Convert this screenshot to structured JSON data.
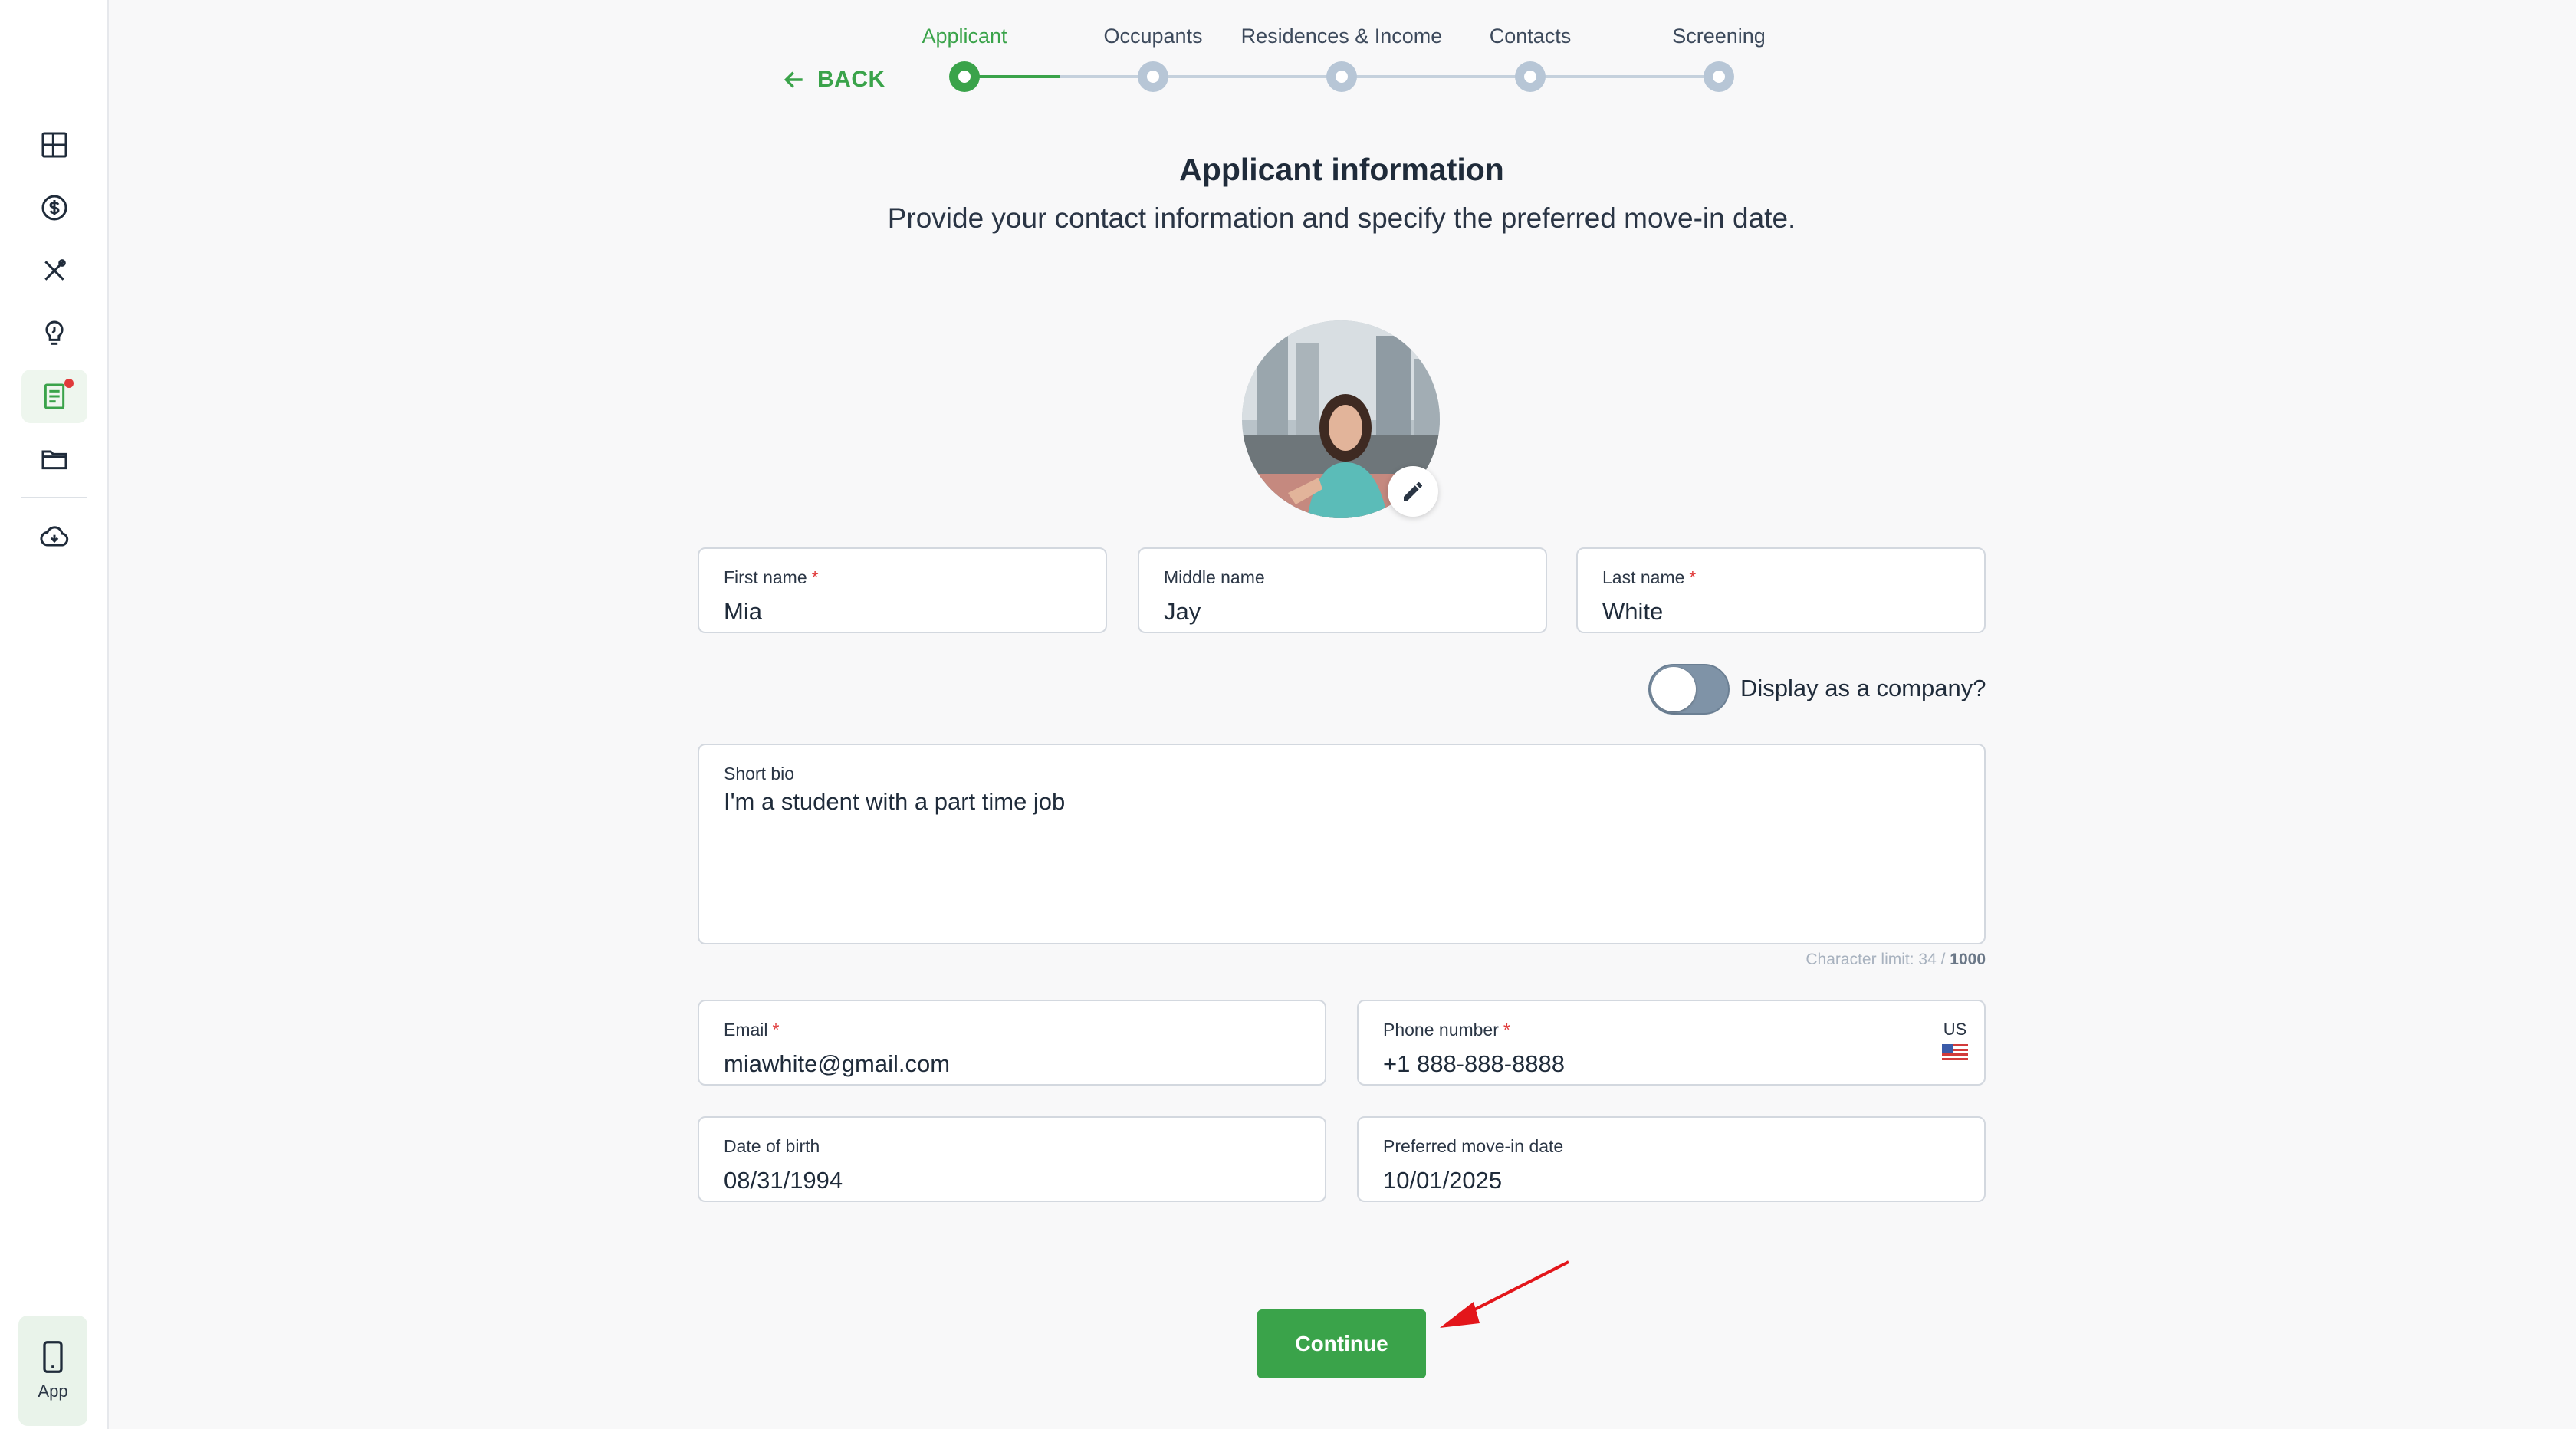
{
  "sidebar": {
    "items": [
      {
        "icon": "dashboard-icon"
      },
      {
        "icon": "dollar-icon"
      },
      {
        "icon": "tools-icon"
      },
      {
        "icon": "lightbulb-icon"
      },
      {
        "icon": "document-icon",
        "active": true,
        "notification": true
      },
      {
        "icon": "folder-icon"
      },
      {
        "icon": "cloud-download-icon"
      }
    ],
    "app_label": "App"
  },
  "nav": {
    "back_label": "BACK"
  },
  "stepper": {
    "steps": [
      "Applicant",
      "Occupants",
      "Residences & Income",
      "Contacts",
      "Screening"
    ],
    "active_index": 0
  },
  "header": {
    "title": "Applicant information",
    "subtitle": "Provide your contact information and specify the preferred move-in date."
  },
  "form": {
    "first_name": {
      "label": "First name",
      "required": "*",
      "value": "Mia"
    },
    "middle_name": {
      "label": "Middle name",
      "value": "Jay"
    },
    "last_name": {
      "label": "Last name",
      "required": "*",
      "value": "White"
    },
    "company_toggle": {
      "label": "Display as a company?",
      "on": false
    },
    "bio": {
      "label": "Short bio",
      "value": "I'm a student with a part time job"
    },
    "char_limit": {
      "text": "Character limit: 34 / ",
      "max": "1000"
    },
    "email": {
      "label": "Email",
      "required": "*",
      "value": "miawhite@gmail.com"
    },
    "phone": {
      "label": "Phone number",
      "required": "*",
      "value": "+1 888-888-8888",
      "country": "US"
    },
    "dob": {
      "label": "Date of birth",
      "value": "08/31/1994"
    },
    "move_in": {
      "label": "Preferred move-in date",
      "value": "10/01/2025"
    }
  },
  "actions": {
    "continue_label": "Continue"
  },
  "colors": {
    "accent": "#3aa34a",
    "required": "#e03a3a",
    "annotation_arrow": "#e3161b"
  }
}
